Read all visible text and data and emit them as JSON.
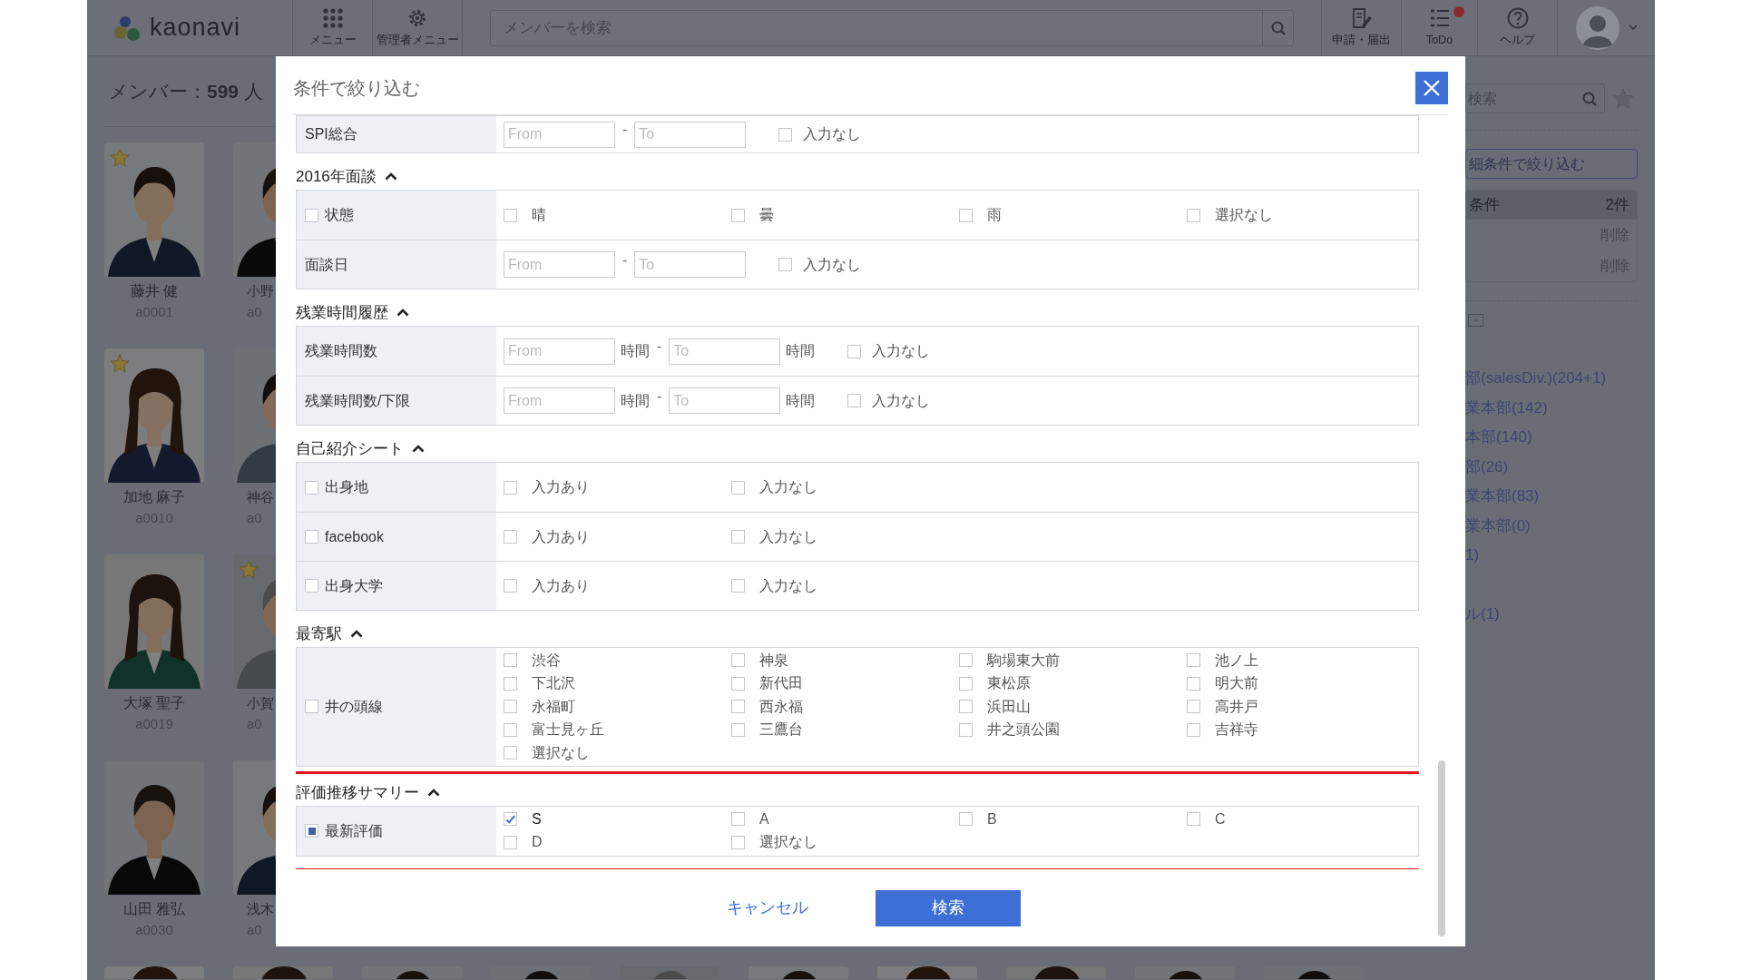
{
  "app_bar": {
    "logo": "kaonavi",
    "nav": [
      {
        "label": "メニュー",
        "kind": "grid"
      },
      {
        "label": "管理者メニュー",
        "kind": "gear"
      }
    ],
    "search": {
      "placeholder": "メンバーを検索"
    },
    "actions": [
      {
        "label": "申請・届出",
        "kind": "document",
        "badge": false
      },
      {
        "label": "ToDo",
        "kind": "list",
        "badge": true
      },
      {
        "label": "ヘルプ",
        "kind": "help",
        "badge": false
      }
    ]
  },
  "member_count": "メンバー：**599** 人",
  "members": [
    {
      "name": "藤井 健",
      "id": "a0001",
      "starred": true
    },
    {
      "name": "加地 麻子",
      "id": "a0010",
      "starred": true
    },
    {
      "name": "大塚 聖子",
      "id": "a0019",
      "starred": false
    },
    {
      "name": "山田 雅弘",
      "id": "a0030",
      "starred": false
    }
  ],
  "members_cut": [
    {
      "name": "小野",
      "id": "a0",
      "starred": false
    },
    {
      "name": "神谷",
      "id": "a0",
      "starred": false
    },
    {
      "name": "小賀",
      "id": "a0",
      "starred": true
    },
    {
      "name": "浅木",
      "id": "a0",
      "starred": false
    }
  ],
  "right_panel": {
    "search": {
      "placeholder": "検索"
    },
    "filter_button": "細条件で絞り込む",
    "conditions": {
      "title": "条件",
      "count": "2件",
      "rows": [
        "削除",
        "削除"
      ]
    },
    "tree": [
      "部(salesDiv.)(204+1)",
      "業本部(142)",
      "本部(140)",
      "部(26)",
      "業本部(83)",
      "業本部(0)",
      "1)",
      "ル(1)"
    ]
  },
  "modal": {
    "title": "条件で絞り込む",
    "cancel": "キャンセル",
    "submit": "検索",
    "sections": [
      {
        "highlighted": false,
        "rows": [
          {
            "kind": "range",
            "label": "SPI総合",
            "from": {
              "placeholder": "From"
            },
            "separator": "-",
            "to": {
              "placeholder": "To"
            },
            "empty_option": {
              "label": "入力なし",
              "checked": false
            }
          }
        ]
      },
      {
        "title": "2016年面談",
        "expanded": true,
        "highlighted": false,
        "rows": [
          {
            "kind": "options",
            "label": "状態",
            "checked": false,
            "partial": false,
            "options": [
              {
                "label": "晴",
                "checked": false
              },
              {
                "label": "曇",
                "checked": false
              },
              {
                "label": "雨",
                "checked": false
              },
              {
                "label": "選択なし",
                "checked": false
              }
            ]
          },
          {
            "kind": "range",
            "label": "面談日",
            "from": {
              "placeholder": "From"
            },
            "separator": "-",
            "to": {
              "placeholder": "To"
            },
            "empty_option": {
              "label": "入力なし",
              "checked": false
            }
          }
        ]
      },
      {
        "title": "残業時間履歴",
        "expanded": true,
        "highlighted": false,
        "rows": [
          {
            "kind": "range",
            "label": "残業時間数",
            "from": {
              "placeholder": "From",
              "unit": "時間"
            },
            "separator": "-",
            "to": {
              "placeholder": "To",
              "unit": "時間"
            },
            "empty_option": {
              "label": "入力なし",
              "checked": false
            }
          },
          {
            "kind": "range",
            "label": "残業時間数/下限",
            "from": {
              "placeholder": "From",
              "unit": "時間"
            },
            "separator": "-",
            "to": {
              "placeholder": "To",
              "unit": "時間"
            },
            "empty_option": {
              "label": "入力なし",
              "checked": false
            }
          }
        ]
      },
      {
        "title": "自己紹介シート",
        "expanded": true,
        "highlighted": false,
        "rows": [
          {
            "kind": "options",
            "label": "出身地",
            "checked": false,
            "partial": false,
            "options": [
              {
                "label": "入力あり",
                "checked": false
              },
              {
                "label": "入力なし",
                "checked": false
              }
            ]
          },
          {
            "kind": "options",
            "label": "facebook",
            "checked": false,
            "partial": false,
            "options": [
              {
                "label": "入力あり",
                "checked": false
              },
              {
                "label": "入力なし",
                "checked": false
              }
            ]
          },
          {
            "kind": "options",
            "label": "出身大学",
            "checked": false,
            "partial": false,
            "options": [
              {
                "label": "入力あり",
                "checked": false
              },
              {
                "label": "入力なし",
                "checked": false
              }
            ]
          }
        ]
      },
      {
        "title": "最寄駅",
        "expanded": true,
        "highlighted": false,
        "rows": [
          {
            "kind": "options",
            "label": "井の頭線",
            "checked": false,
            "partial": false,
            "options": [
              {
                "label": "渋谷",
                "checked": false
              },
              {
                "label": "神泉",
                "checked": false
              },
              {
                "label": "駒場東大前",
                "checked": false
              },
              {
                "label": "池ノ上",
                "checked": false
              },
              {
                "label": "下北沢",
                "checked": false
              },
              {
                "label": "新代田",
                "checked": false
              },
              {
                "label": "東松原",
                "checked": false
              },
              {
                "label": "明大前",
                "checked": false
              },
              {
                "label": "永福町",
                "checked": false
              },
              {
                "label": "西永福",
                "checked": false
              },
              {
                "label": "浜田山",
                "checked": false
              },
              {
                "label": "高井戸",
                "checked": false
              },
              {
                "label": "富士見ヶ丘",
                "checked": false
              },
              {
                "label": "三鷹台",
                "checked": false
              },
              {
                "label": "井之頭公園",
                "checked": false
              },
              {
                "label": "吉祥寺",
                "checked": false
              },
              {
                "label": "選択なし",
                "checked": false
              }
            ]
          }
        ]
      },
      {
        "title": "評価推移サマリー",
        "expanded": true,
        "highlighted": true,
        "rows": [
          {
            "kind": "options",
            "label": "最新評価",
            "checked": false,
            "partial": true,
            "options": [
              {
                "label": "S",
                "checked": true
              },
              {
                "label": "A",
                "checked": false
              },
              {
                "label": "B",
                "checked": false
              },
              {
                "label": "C",
                "checked": false
              },
              {
                "label": "D",
                "checked": false
              },
              {
                "label": "選択なし",
                "checked": false
              }
            ]
          }
        ]
      }
    ]
  }
}
